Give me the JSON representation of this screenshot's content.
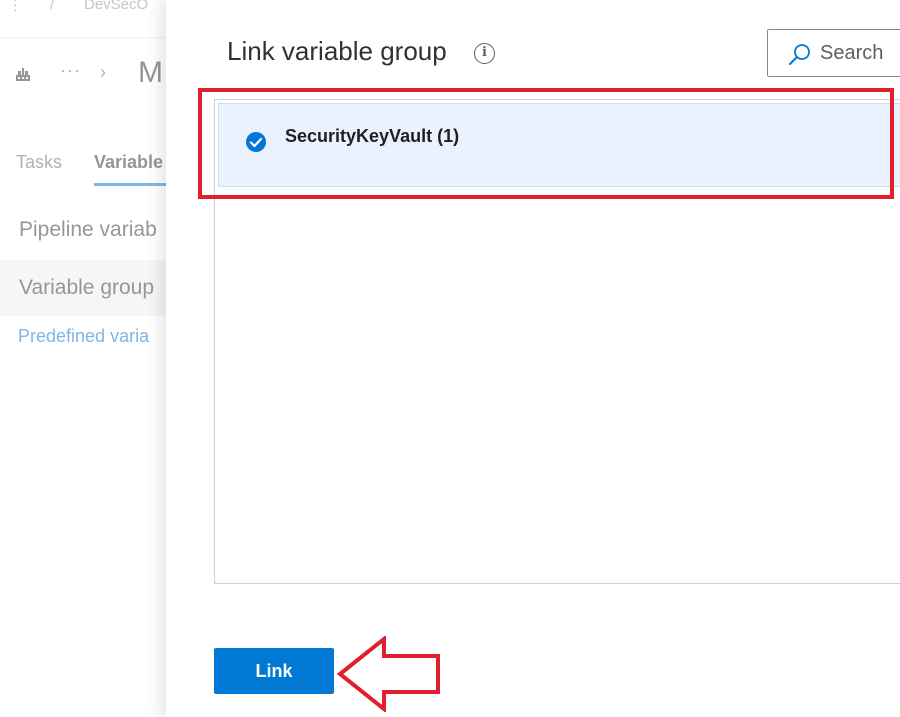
{
  "background": {
    "breadcrumb": {
      "more": "⋮",
      "separator": "/",
      "crumb": "DevSecO"
    },
    "titlebar": {
      "more": "···",
      "chevron": "›",
      "title": "M"
    },
    "tabs": [
      {
        "label": "Tasks"
      },
      {
        "label": "Variable"
      }
    ],
    "sidebar": {
      "pipeline_variables": "Pipeline variab",
      "variable_groups": "Variable group",
      "predefined_link": "Predefined varia"
    }
  },
  "panel": {
    "title": "Link variable group",
    "info_icon_glyph": "i",
    "search": {
      "placeholder": "Search"
    },
    "groups": [
      {
        "name": "SecurityKeyVault (1)",
        "selected": true
      }
    ],
    "link_button_label": "Link"
  },
  "colors": {
    "accent": "#0078d4",
    "selected_row": "#eaf3fd",
    "annotation": "#e0202e"
  }
}
